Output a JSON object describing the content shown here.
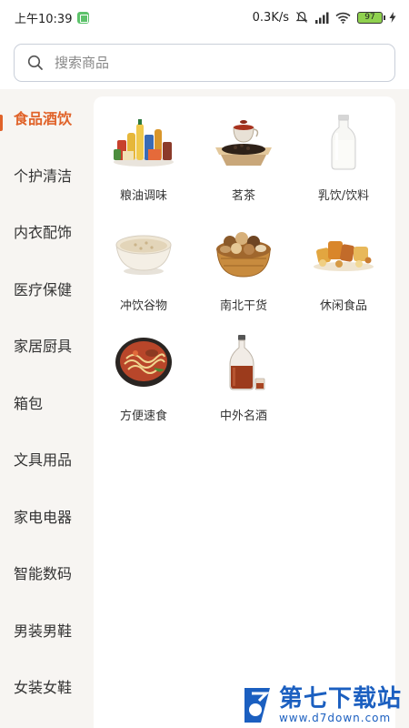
{
  "status_bar": {
    "time": "上午10:39",
    "network_speed": "0.3K/s",
    "battery": "97"
  },
  "search": {
    "placeholder": "搜索商品"
  },
  "sidebar": {
    "items": [
      {
        "label": "食品酒饮",
        "active": true
      },
      {
        "label": "个护清洁",
        "active": false
      },
      {
        "label": "内衣配饰",
        "active": false
      },
      {
        "label": "医疗保健",
        "active": false
      },
      {
        "label": "家居厨具",
        "active": false
      },
      {
        "label": "箱包",
        "active": false
      },
      {
        "label": "文具用品",
        "active": false
      },
      {
        "label": "家电电器",
        "active": false
      },
      {
        "label": "智能数码",
        "active": false
      },
      {
        "label": "男装男鞋",
        "active": false
      },
      {
        "label": "女装女鞋",
        "active": false
      }
    ]
  },
  "categories": [
    {
      "label": "粮油调味",
      "icon": "grocery-assortment-icon"
    },
    {
      "label": "茗茶",
      "icon": "tea-icon"
    },
    {
      "label": "乳饮/饮料",
      "icon": "milk-bottle-icon"
    },
    {
      "label": "冲饮谷物",
      "icon": "oatmeal-bowl-icon"
    },
    {
      "label": "南北干货",
      "icon": "nuts-basket-icon"
    },
    {
      "label": "休闲食品",
      "icon": "snacks-icon"
    },
    {
      "label": "方便速食",
      "icon": "noodle-bowl-icon"
    },
    {
      "label": "中外名酒",
      "icon": "liquor-bottle-icon"
    }
  ],
  "watermark": {
    "title": "第七下载站",
    "url": "www.d7down.com"
  },
  "colors": {
    "accent": "#e0632a",
    "brand": "#1b5fc0"
  }
}
